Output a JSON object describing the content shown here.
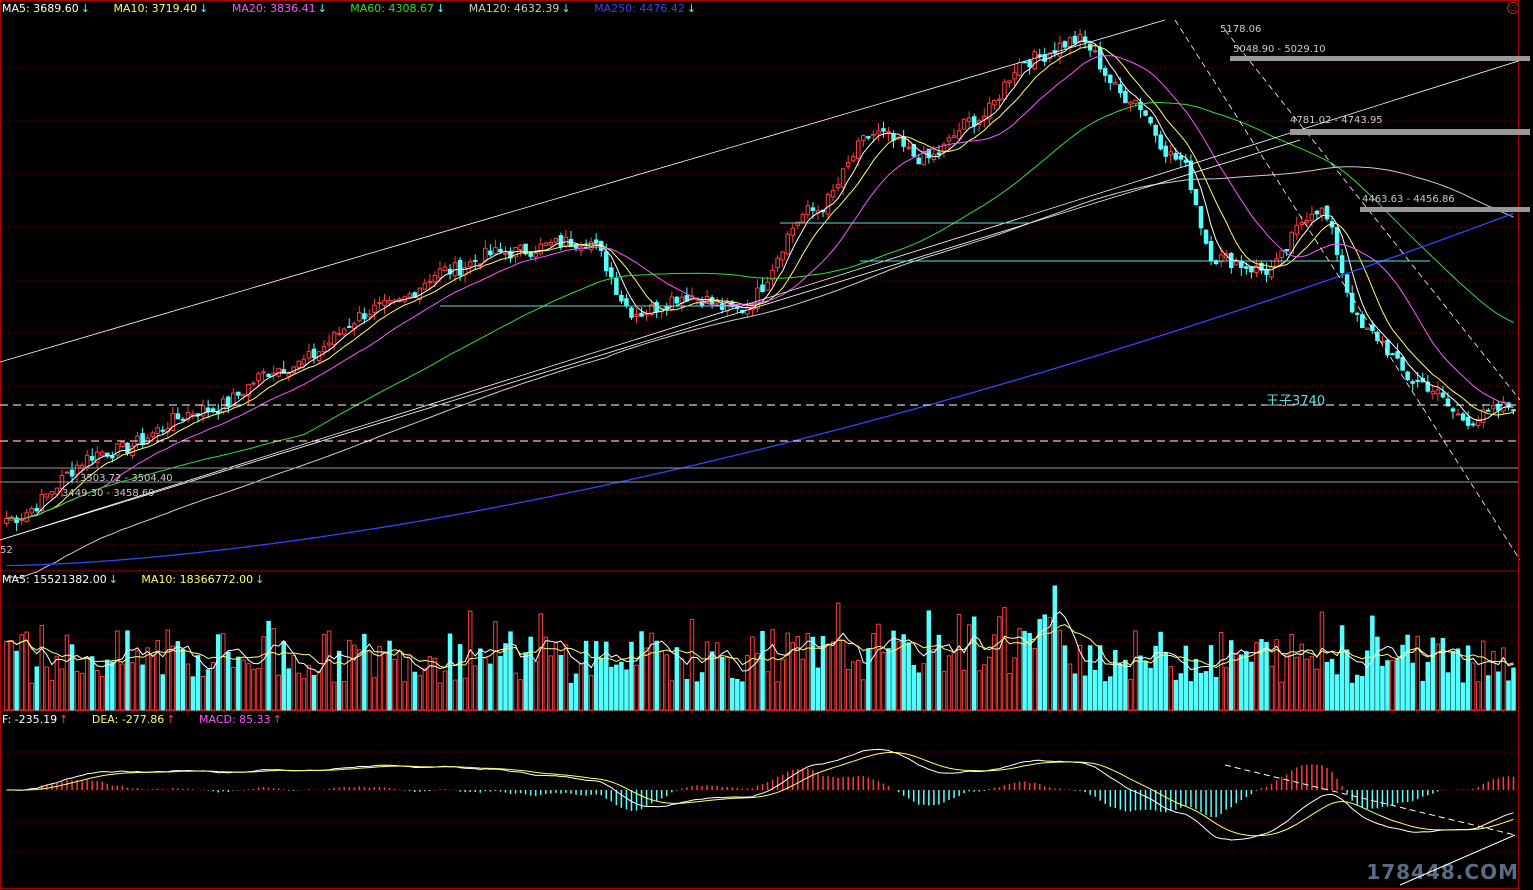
{
  "price_legend": [
    {
      "label": "MA5: 3689.60",
      "color": "#ffffff",
      "arrow": "↓"
    },
    {
      "label": "MA10: 3719.40",
      "color": "#ffff66",
      "arrow": "↓"
    },
    {
      "label": "MA20: 3836.41",
      "color": "#ff55ff",
      "arrow": "↓"
    },
    {
      "label": "MA60: 4308.67",
      "color": "#33dd33",
      "arrow": "↓"
    },
    {
      "label": "MA120: 4632.39",
      "color": "#cccccc",
      "arrow": "↓"
    },
    {
      "label": "MA250: 4476.42",
      "color": "#3344ff",
      "arrow": "↓"
    }
  ],
  "volume_legend": [
    {
      "label": "MA5: 15521382.00",
      "color": "#ffffff",
      "arrow": "↓"
    },
    {
      "label": "MA10: 18366772.00",
      "color": "#ffff66",
      "arrow": "↓"
    }
  ],
  "macd_legend": [
    {
      "label": "F: -235.19",
      "color": "#ffffff",
      "arrow": "↑"
    },
    {
      "label": "DEA: -277.86",
      "color": "#ffff66",
      "arrow": "↑"
    },
    {
      "label": "MACD: 85.33",
      "color": "#ff55ff",
      "arrow": "↑"
    }
  ],
  "annotations": {
    "peak": "5178.06",
    "zone1": "5048.90 - 5029.10",
    "zone2": "4781.02 - 4743.95",
    "zone3": "4463.63 - 4456.86",
    "zone4": "3503.72 - 3504.40",
    "zone5": "3449.30 - 3458.69",
    "support": "王子3740",
    "low_edge": "52"
  },
  "watermark": "178448.COM",
  "close_symbol": "○",
  "colors": {
    "up": "#ff3c3c",
    "down": "#54ffff",
    "grid": "#8b0000",
    "frame": "#aa0000",
    "ma5": "#ffffff",
    "ma10": "#ffff66",
    "ma20": "#ff55ff",
    "ma60": "#33dd33",
    "ma120": "#cccccc",
    "ma250": "#3344ff",
    "trend": "#ffffff",
    "zone": "#999999"
  },
  "chart_data": [
    {
      "type": "candlestick",
      "series": [
        {
          "name": "MA5",
          "last": 3689.6
        },
        {
          "name": "MA10",
          "last": 3719.4
        },
        {
          "name": "MA20",
          "last": 3836.41
        },
        {
          "name": "MA60",
          "last": 4308.67
        },
        {
          "name": "MA120",
          "last": 4632.39
        },
        {
          "name": "MA250",
          "last": 4476.42
        }
      ],
      "key_levels": [
        5178.06,
        5048.9,
        5029.1,
        4781.02,
        4743.95,
        4463.63,
        4456.86,
        3740,
        3503.72,
        3504.4,
        3449.3,
        3458.69
      ],
      "close_anchors": [
        [
          0,
          3250
        ],
        [
          40,
          3520
        ],
        [
          80,
          3690
        ],
        [
          110,
          3860
        ],
        [
          150,
          4100
        ],
        [
          175,
          4250
        ],
        [
          195,
          4320
        ],
        [
          230,
          4370
        ],
        [
          250,
          4080
        ],
        [
          270,
          4150
        ],
        [
          290,
          4090
        ],
        [
          320,
          4490
        ],
        [
          345,
          4800
        ],
        [
          365,
          4700
        ],
        [
          385,
          4860
        ],
        [
          405,
          5100
        ],
        [
          425,
          5178
        ],
        [
          445,
          4950
        ],
        [
          465,
          4700
        ],
        [
          480,
          4300
        ],
        [
          500,
          4250
        ],
        [
          520,
          4500
        ],
        [
          540,
          4000
        ],
        [
          560,
          3800
        ],
        [
          580,
          3650
        ],
        [
          600,
          3710
        ]
      ]
    },
    {
      "type": "bar",
      "series": [
        {
          "name": "MA5",
          "last": 15521382.0
        },
        {
          "name": "MA10",
          "last": 18366772.0
        }
      ]
    },
    {
      "type": "bar",
      "series": [
        {
          "name": "F",
          "last": -235.19
        },
        {
          "name": "DEA",
          "last": -277.86
        },
        {
          "name": "MACD",
          "last": 85.33
        }
      ]
    }
  ]
}
